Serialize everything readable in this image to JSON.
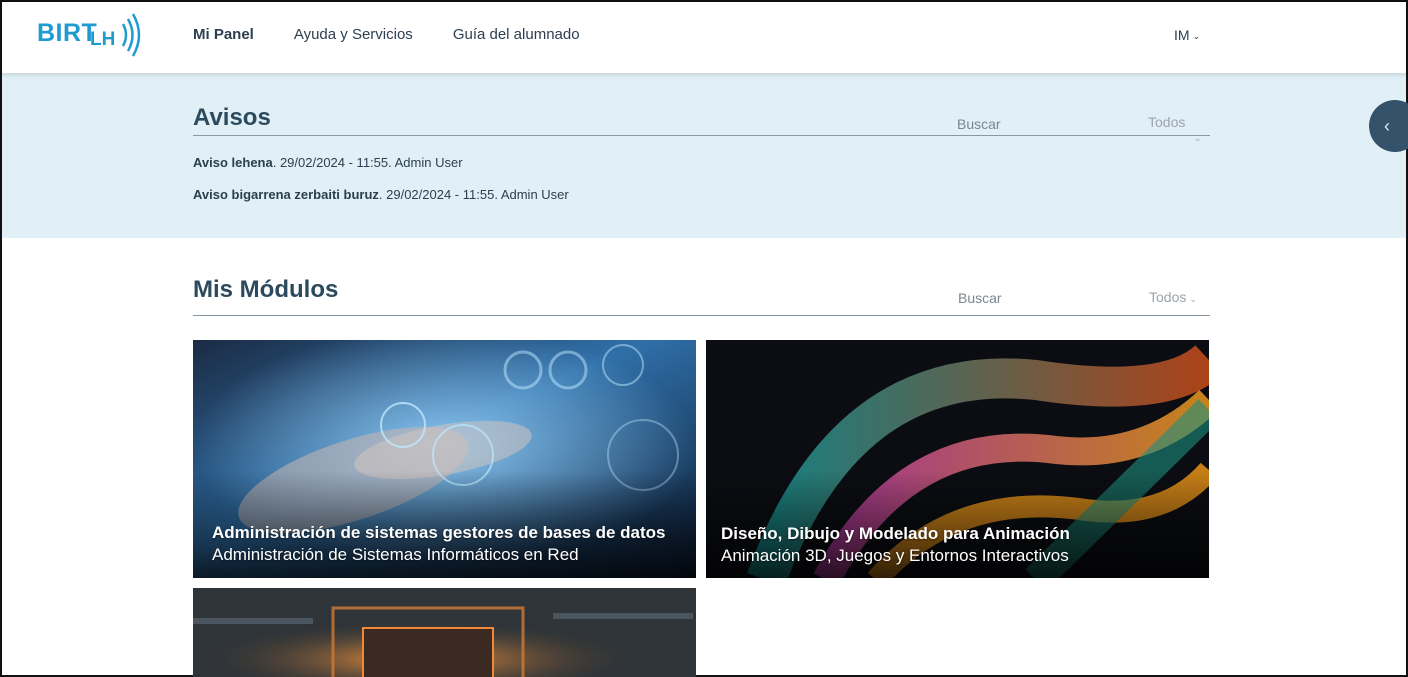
{
  "header": {
    "logo_text": "BIRT",
    "logo_sub": "LH",
    "nav": [
      "Mi Panel",
      "Ayuda y Servicios",
      "Guía del alumnado"
    ],
    "user_initials": "IM"
  },
  "avisos": {
    "title": "Avisos",
    "search_placeholder": "Buscar",
    "filter_label": "Todos",
    "items": [
      {
        "title": "Aviso lehena",
        "meta": ". 29/02/2024 - 11:55. Admin User"
      },
      {
        "title": "Aviso bigarrena zerbaiti buruz",
        "meta": ". 29/02/2024 - 11:55. Admin User"
      }
    ]
  },
  "modulos": {
    "title": "Mis Módulos",
    "search_placeholder": "Buscar",
    "filter_label": "Todos",
    "cards": [
      {
        "title": "Administración de sistemas gestores de bases de datos",
        "subtitle": "Administración de Sistemas Informáticos en Red"
      },
      {
        "title": "Diseño, Dibujo y Modelado para Animación",
        "subtitle": "Animación 3D, Juegos y Entornos Interactivos"
      },
      {
        "title": "",
        "subtitle": ""
      }
    ]
  },
  "colors": {
    "brand": "#1f9bd1",
    "avisos_bg": "#e0f0f6",
    "text": "#2c3e50",
    "toggle": "#34526a"
  }
}
